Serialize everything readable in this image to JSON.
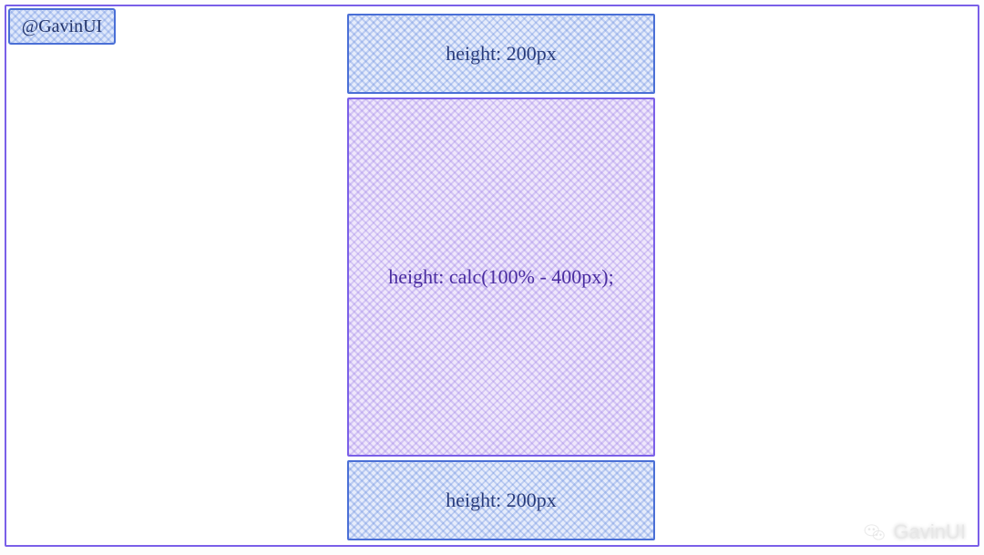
{
  "badge": {
    "label": "@GavinUI"
  },
  "layout": {
    "top": {
      "label": "height: 200px"
    },
    "middle": {
      "label": "height: calc(100% - 400px);"
    },
    "bottom": {
      "label": "height: 200px"
    }
  },
  "watermark": {
    "icon": "wechat-icon",
    "text": "GavinUI"
  },
  "colors": {
    "frame": "#7a5fe8",
    "blue": "#4a6fd6",
    "purple": "#7a5fe8"
  }
}
